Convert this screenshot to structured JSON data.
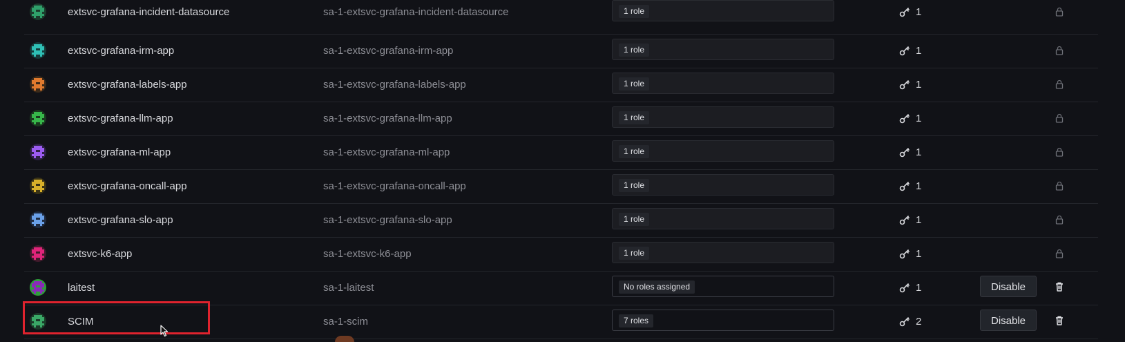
{
  "service_accounts": [
    {
      "name": "extsvc-grafana-incident-datasource",
      "login": "sa-1-extsvc-grafana-incident-datasource",
      "roles": "1 role",
      "tokens": "1",
      "action": "locked",
      "avatar_color": "#2fa06a",
      "avatar_bg": "#1b3b2c"
    },
    {
      "name": "extsvc-grafana-irm-app",
      "login": "sa-1-extsvc-grafana-irm-app",
      "roles": "1 role",
      "tokens": "1",
      "action": "locked",
      "avatar_color": "#2fbfb5",
      "avatar_bg": "#163a39"
    },
    {
      "name": "extsvc-grafana-labels-app",
      "login": "sa-1-extsvc-grafana-labels-app",
      "roles": "1 role",
      "tokens": "1",
      "action": "locked",
      "avatar_color": "#e07a2e",
      "avatar_bg": "#3b2a1a"
    },
    {
      "name": "extsvc-grafana-llm-app",
      "login": "sa-1-extsvc-grafana-llm-app",
      "roles": "1 role",
      "tokens": "1",
      "action": "locked",
      "avatar_color": "#37b74a",
      "avatar_bg": "#1a3a1f"
    },
    {
      "name": "extsvc-grafana-ml-app",
      "login": "sa-1-extsvc-grafana-ml-app",
      "roles": "1 role",
      "tokens": "1",
      "action": "locked",
      "avatar_color": "#9b5cf0",
      "avatar_bg": "#2d2046"
    },
    {
      "name": "extsvc-grafana-oncall-app",
      "login": "sa-1-extsvc-grafana-oncall-app",
      "roles": "1 role",
      "tokens": "1",
      "action": "locked",
      "avatar_color": "#d8b02a",
      "avatar_bg": "#3a3316"
    },
    {
      "name": "extsvc-grafana-slo-app",
      "login": "sa-1-extsvc-grafana-slo-app",
      "roles": "1 role",
      "tokens": "1",
      "action": "locked",
      "avatar_color": "#6aa0e8",
      "avatar_bg": "#1f2b40"
    },
    {
      "name": "extsvc-k6-app",
      "login": "sa-1-extsvc-k6-app",
      "roles": "1 role",
      "tokens": "1",
      "action": "locked",
      "avatar_color": "#e0247a",
      "avatar_bg": "#421a2c"
    },
    {
      "name": "laitest",
      "login": "sa-1-laitest",
      "roles": "No roles assigned",
      "tokens": "1",
      "action": "disable",
      "avatar_color": "#8a2ab8",
      "avatar_bg": "#2f9e3a"
    },
    {
      "name": "SCIM",
      "login": "sa-1-scim",
      "roles": "7 roles",
      "tokens": "2",
      "action": "disable",
      "avatar_color": "#3aa866",
      "avatar_bg": "#1b3a28"
    }
  ],
  "labels": {
    "disable_button": "Disable"
  },
  "icons": {
    "token": "key-icon",
    "locked": "lock-icon",
    "delete": "trash-icon"
  },
  "colors": {
    "highlight_box": "#e0232e"
  }
}
